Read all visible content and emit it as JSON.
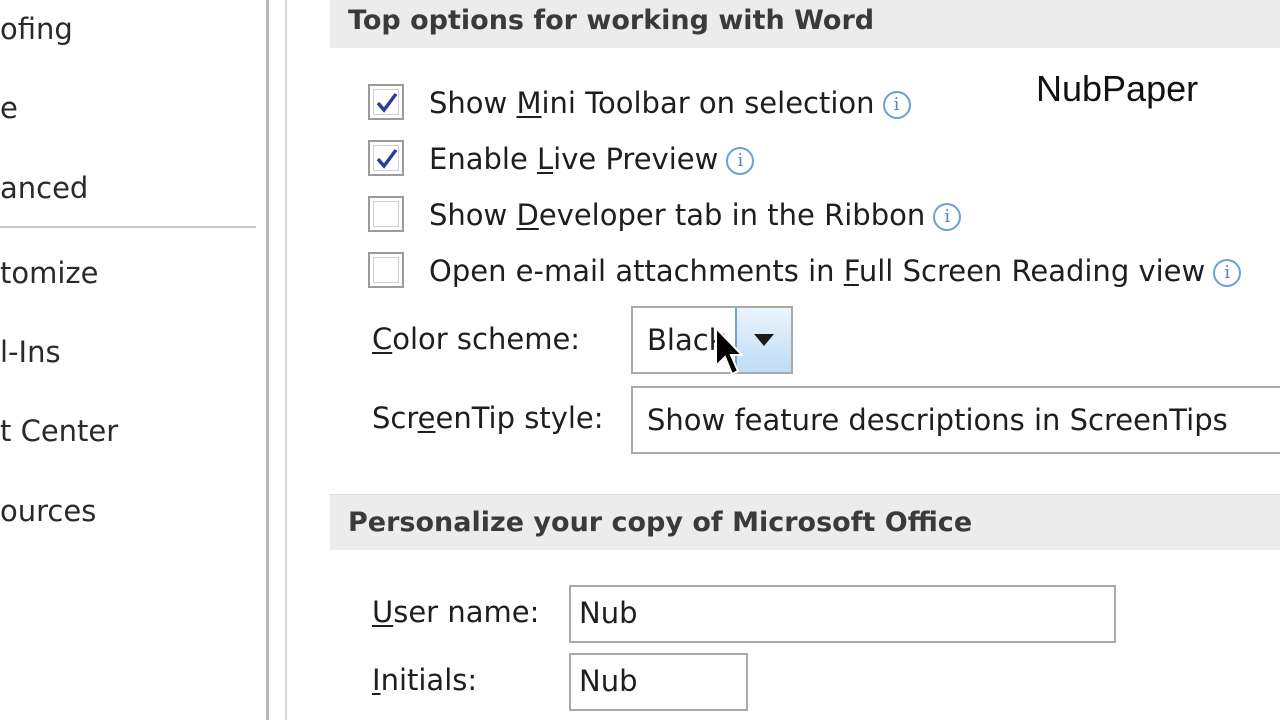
{
  "nav": {
    "items": [
      "ofing",
      "e",
      "anced",
      "tomize",
      "l-Ins",
      "t Center",
      "ources"
    ]
  },
  "sections": {
    "top_options_title": "Top options for working with Word",
    "personalize_title": "Personalize your copy of Microsoft Office"
  },
  "options": {
    "mini_toolbar": {
      "pre": "Show ",
      "ul": "M",
      "post": "ini Toolbar on selection",
      "checked": true
    },
    "live_preview": {
      "pre": "Enable ",
      "ul": "L",
      "post": "ive Preview",
      "checked": true
    },
    "developer_tab": {
      "pre": "Show ",
      "ul": "D",
      "post": "eveloper tab in the Ribbon",
      "checked": false
    },
    "email_attachments": {
      "pre": "Open e-mail attachments in ",
      "ul": "F",
      "post": "ull Screen Reading view",
      "checked": false
    }
  },
  "color_scheme": {
    "label_ul": "C",
    "label_rest": "olor scheme:",
    "value": "Black"
  },
  "screentip": {
    "label_pre": "Scr",
    "label_ul": "e",
    "label_post": "enTip style:",
    "value": "Show feature descriptions in ScreenTips"
  },
  "user": {
    "username_label_ul": "U",
    "username_label_rest": "ser name:",
    "username_value": "Nub",
    "initials_label_ul": "I",
    "initials_label_rest": "nitials:",
    "initials_value": "Nub"
  },
  "watermark": "NubPaper",
  "info_glyph": "i",
  "colors": {
    "accent": "#4f86c6",
    "checkmark": "#2a3f9d",
    "section_bg": "#ececec"
  }
}
